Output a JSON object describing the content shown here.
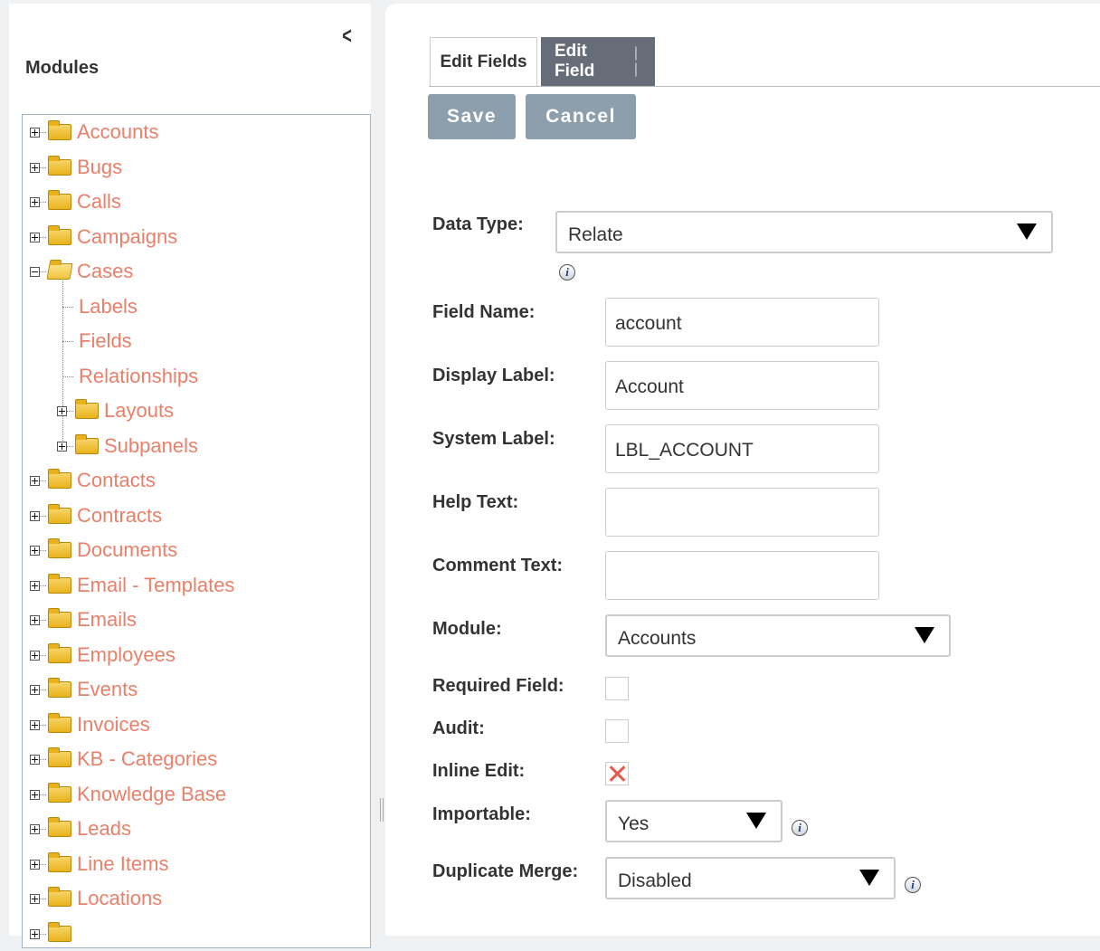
{
  "sidebar": {
    "collapse_label": "<",
    "title": "Modules",
    "items": [
      {
        "label": "Accounts"
      },
      {
        "label": "Bugs"
      },
      {
        "label": "Calls"
      },
      {
        "label": "Campaigns"
      },
      {
        "label": "Cases",
        "expanded": true,
        "children": [
          {
            "label": "Labels"
          },
          {
            "label": "Fields"
          },
          {
            "label": "Relationships"
          },
          {
            "label": "Layouts"
          },
          {
            "label": "Subpanels"
          }
        ]
      },
      {
        "label": "Contacts"
      },
      {
        "label": "Contracts"
      },
      {
        "label": "Documents"
      },
      {
        "label": "Email - Templates"
      },
      {
        "label": "Emails"
      },
      {
        "label": "Employees"
      },
      {
        "label": "Events"
      },
      {
        "label": "Invoices"
      },
      {
        "label": "KB - Categories"
      },
      {
        "label": "Knowledge Base"
      },
      {
        "label": "Leads"
      },
      {
        "label": "Line Items"
      },
      {
        "label": "Locations"
      }
    ]
  },
  "tabs": {
    "edit_fields": "Edit Fields",
    "edit_field": "Edit Field",
    "edit_field_suffix": "| |"
  },
  "buttons": {
    "save": "Save",
    "cancel": "Cancel"
  },
  "form": {
    "data_type": {
      "label": "Data Type:",
      "value": "Relate"
    },
    "field_name": {
      "label": "Field Name:",
      "value": "account"
    },
    "display_label": {
      "label": "Display Label:",
      "value": "Account"
    },
    "system_label": {
      "label": "System Label:",
      "value": "LBL_ACCOUNT"
    },
    "help_text": {
      "label": "Help Text:",
      "value": ""
    },
    "comment_text": {
      "label": "Comment Text:",
      "value": ""
    },
    "module": {
      "label": "Module:",
      "value": "Accounts"
    },
    "required_field": {
      "label": "Required Field:",
      "checked": false
    },
    "audit": {
      "label": "Audit:",
      "checked": false
    },
    "inline_edit": {
      "label": "Inline Edit:",
      "checked": true
    },
    "importable": {
      "label": "Importable:",
      "value": "Yes"
    },
    "duplicate_merge": {
      "label": "Duplicate Merge:",
      "value": "Disabled"
    },
    "info_glyph": "i"
  },
  "colors": {
    "link": "#e8806a",
    "tab_active": "#666d78",
    "button": "#8d9eac",
    "check": "#e8574a"
  }
}
